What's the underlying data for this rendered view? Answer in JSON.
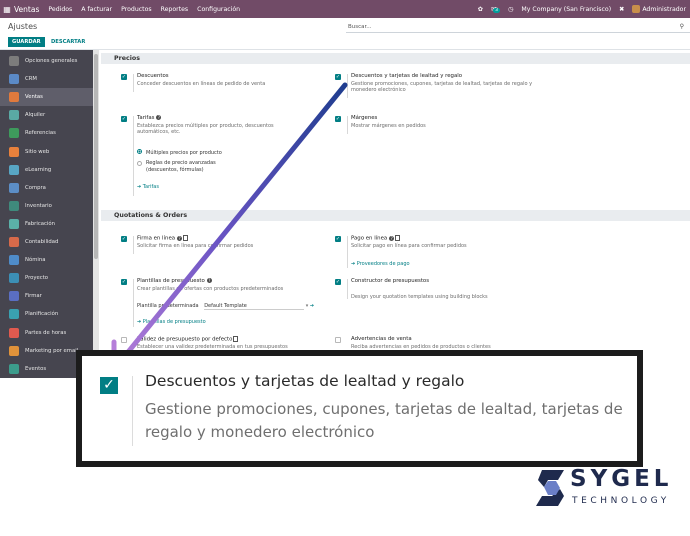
{
  "topnav": {
    "brand": "Ventas",
    "menu": [
      "Pedidos",
      "A facturar",
      "Productos",
      "Reportes",
      "Configuración"
    ],
    "chat_badge": "3",
    "company": "My Company (San Francisco)",
    "user": "Administrador"
  },
  "control_panel": {
    "title": "Ajustes",
    "save_label": "GUARDAR",
    "discard_label": "DESCARTAR",
    "search_placeholder": "Buscar..."
  },
  "sidebar": {
    "items": [
      {
        "label": "Opciones generales",
        "icon": "settings-icon",
        "color": "#7c7c7c",
        "active": false
      },
      {
        "label": "CRM",
        "icon": "crm-icon",
        "color": "#5b8ac7",
        "active": false
      },
      {
        "label": "Ventas",
        "icon": "sales-icon",
        "color": "#e07a3d",
        "active": true
      },
      {
        "label": "Alquiler",
        "icon": "rental-icon",
        "color": "#5aa9a4",
        "active": false
      },
      {
        "label": "Referencias",
        "icon": "referral-icon",
        "color": "#3e9a5c",
        "active": false
      },
      {
        "label": "Sitio web",
        "icon": "website-icon",
        "color": "#e8813c",
        "active": false
      },
      {
        "label": "eLearning",
        "icon": "elearning-icon",
        "color": "#58a6c4",
        "active": false
      },
      {
        "label": "Compra",
        "icon": "purchase-icon",
        "color": "#5c8ec6",
        "active": false
      },
      {
        "label": "Inventario",
        "icon": "inventory-icon",
        "color": "#3f8a7c",
        "active": false
      },
      {
        "label": "Fabricación",
        "icon": "manufacturing-icon",
        "color": "#5bb0a8",
        "active": false
      },
      {
        "label": "Contabilidad",
        "icon": "accounting-icon",
        "color": "#d66a4a",
        "active": false
      },
      {
        "label": "Nómina",
        "icon": "payroll-icon",
        "color": "#4f8cc9",
        "active": false
      },
      {
        "label": "Proyecto",
        "icon": "project-icon",
        "color": "#3c8fb5",
        "active": false
      },
      {
        "label": "Firmar",
        "icon": "sign-icon",
        "color": "#5a6ec2",
        "active": false
      },
      {
        "label": "Planificación",
        "icon": "planning-icon",
        "color": "#3aa0b0",
        "active": false
      },
      {
        "label": "Partes de horas",
        "icon": "timesheet-icon",
        "color": "#e05a4f",
        "active": false
      },
      {
        "label": "Marketing por email",
        "icon": "email-marketing-icon",
        "color": "#e0923a",
        "active": false
      },
      {
        "label": "Eventos",
        "icon": "events-icon",
        "color": "#3c9c8c",
        "active": false
      }
    ]
  },
  "sections": {
    "prices": "Precios",
    "quotations": "Quotations & Orders"
  },
  "settings": {
    "discounts": {
      "name": "Descuentos",
      "desc": "Conceder descuentos en líneas de pedido de venta",
      "checked": true
    },
    "loyalty": {
      "name": "Descuentos y tarjetas de lealtad y regalo",
      "desc": "Gestione promociones, cupones, tarjetas de lealtad, tarjetas de regalo y monedero electrónico",
      "checked": true
    },
    "pricelists": {
      "name": "Tarifas",
      "desc": "Establezca precios múltiples por producto, descuentos automáticos, etc.",
      "checked": true,
      "radio_multi": "Múltiples precios por producto",
      "radio_adv": "Reglas de precio avanzadas (descuentos, fórmulas)",
      "link": "Tarifas"
    },
    "margins": {
      "name": "Márgenes",
      "desc": "Mostrar márgenes en pedidos",
      "checked": true
    },
    "online_sign": {
      "name": "Firma en línea",
      "desc": "Solicitar firma en línea para confirmar pedidos",
      "checked": true
    },
    "online_pay": {
      "name": "Pago en línea",
      "desc": "Solicitar pago en línea para confirmar pedidos",
      "checked": true,
      "link": "Proveedores de pago"
    },
    "quote_templates": {
      "name": "Plantillas de presupuesto",
      "desc": "Crear plantillas de ofertas con productos predeterminados",
      "checked": true,
      "default_label": "Plantilla predeterminada",
      "default_value": "Default Template",
      "link": "Plantillas de presupuesto"
    },
    "quote_builder": {
      "name": "Constructor de presupuestos",
      "desc": "Design your quotation templates using building blocks",
      "checked": true
    },
    "quote_validity": {
      "name": "Validez de presupuesto por defecto",
      "desc": "Establecer una validez predeterminada en tus presupuestos",
      "checked": false
    },
    "sale_warnings": {
      "name": "Advertencias de venta",
      "desc": "Reciba advertencias en pedidos de productos o clientes",
      "checked": false
    }
  },
  "callout": {
    "name": "Descuentos y tarjetas de lealtad y regalo",
    "desc": "Gestione promociones, cupones, tarjetas de lealtad, tarjetas de regalo y monedero electrónico"
  },
  "logo": {
    "word": "SYGEL",
    "sub": "TECHNOLOGY"
  },
  "colors": {
    "navbar": "#714b67",
    "primary": "#017e84",
    "sidebar": "#46454f",
    "arrow": "#8a5cc7",
    "logo": "#1f2a4d"
  }
}
